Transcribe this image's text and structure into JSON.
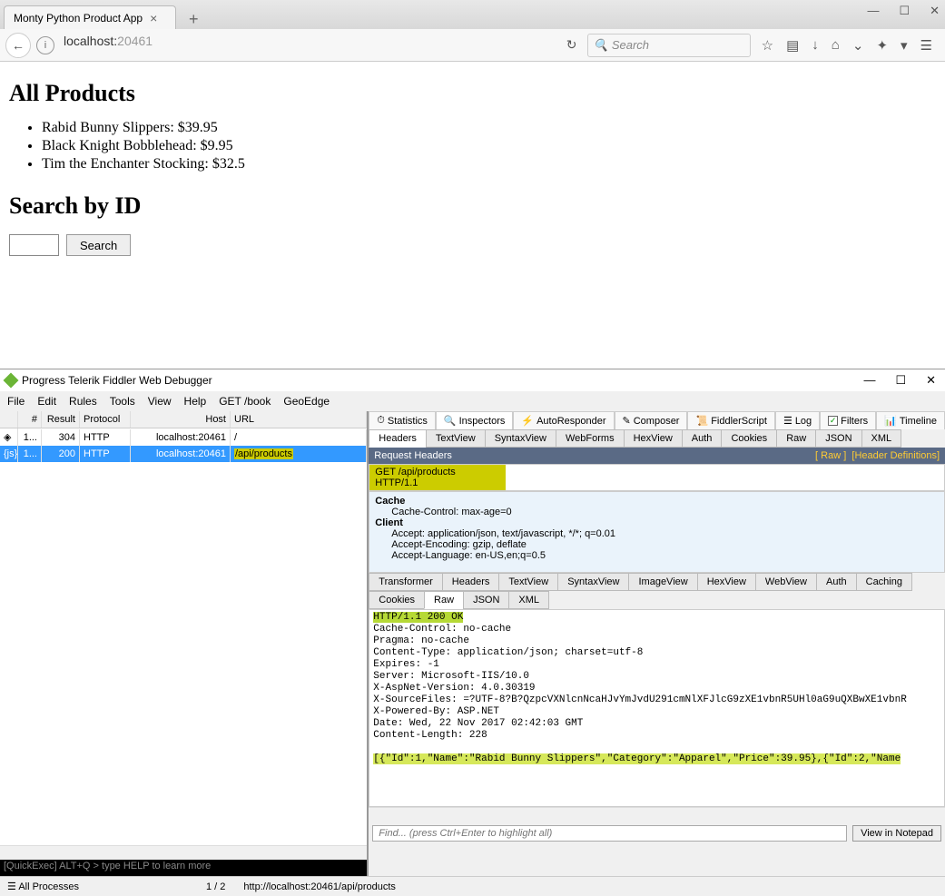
{
  "browser": {
    "tab_title": "Monty Python Product App",
    "url_host": "localhost:",
    "url_port": "20461",
    "search_placeholder": "Search",
    "win": {
      "min": "—",
      "max": "☐",
      "close": "✕"
    }
  },
  "page": {
    "h1": "All Products",
    "products": [
      "Rabid Bunny Slippers: $39.95",
      "Black Knight Bobblehead: $9.95",
      "Tim the Enchanter Stocking: $32.5"
    ],
    "h2": "Search by ID",
    "search_btn": "Search"
  },
  "fiddler": {
    "title": "Progress Telerik Fiddler Web Debugger",
    "menu": [
      "File",
      "Edit",
      "Rules",
      "Tools",
      "View",
      "Help",
      "GET /book",
      "GeoEdge"
    ],
    "grid_headers": [
      "#",
      "Result",
      "Protocol",
      "Host",
      "URL"
    ],
    "rows": [
      {
        "num": "1...",
        "result": "304",
        "proto": "HTTP",
        "host": "localhost:20461",
        "url": "/",
        "sel": false
      },
      {
        "num": "1...",
        "result": "200",
        "proto": "HTTP",
        "host": "localhost:20461",
        "url": "/api/products",
        "sel": true
      }
    ],
    "quickexec": "[QuickExec] ALT+Q > type HELP to learn more",
    "tabs1": [
      "Statistics",
      "Inspectors",
      "AutoResponder",
      "Composer",
      "FiddlerScript",
      "Log",
      "Filters",
      "Timeline"
    ],
    "tabs2": [
      "Headers",
      "TextView",
      "SyntaxView",
      "WebForms",
      "HexView",
      "Auth",
      "Cookies",
      "Raw",
      "JSON",
      "XML"
    ],
    "req_title": "Request Headers",
    "req_raw": "[ Raw ]",
    "req_defs": "[Header Definitions]",
    "req_line": "GET /api/products HTTP/1.1",
    "cache_h": "Cache",
    "cache_v": "Cache-Control: max-age=0",
    "client_h": "Client",
    "client": [
      "Accept: application/json, text/javascript, */*; q=0.01",
      "Accept-Encoding: gzip, deflate",
      "Accept-Language: en-US,en;q=0.5"
    ],
    "tabs3a": [
      "Transformer",
      "Headers",
      "TextView",
      "SyntaxView",
      "ImageView",
      "HexView",
      "WebView",
      "Auth",
      "Caching"
    ],
    "tabs3b": [
      "Cookies",
      "Raw",
      "JSON",
      "XML"
    ],
    "resp_status": "HTTP/1.1 200 OK",
    "resp_headers": "Cache-Control: no-cache\nPragma: no-cache\nContent-Type: application/json; charset=utf-8\nExpires: -1\nServer: Microsoft-IIS/10.0\nX-AspNet-Version: 4.0.30319\nX-SourceFiles: =?UTF-8?B?QzpcVXNlcnNcaHJvYmJvdU291cmNlXFJlcG9zXE1vbnR5UHl0aG9uQXBwXE1vbnR\nX-Powered-By: ASP.NET\nDate: Wed, 22 Nov 2017 02:42:03 GMT\nContent-Length: 228",
    "resp_body": "[{\"Id\":1,\"Name\":\"Rabid Bunny Slippers\",\"Category\":\"Apparel\",\"Price\":39.95},{\"Id\":2,\"Name",
    "find_placeholder": "Find... (press Ctrl+Enter to highlight all)",
    "notepad": "View in Notepad",
    "status": {
      "proc": "All Processes",
      "count": "1 / 2",
      "url": "http://localhost:20461/api/products"
    }
  }
}
